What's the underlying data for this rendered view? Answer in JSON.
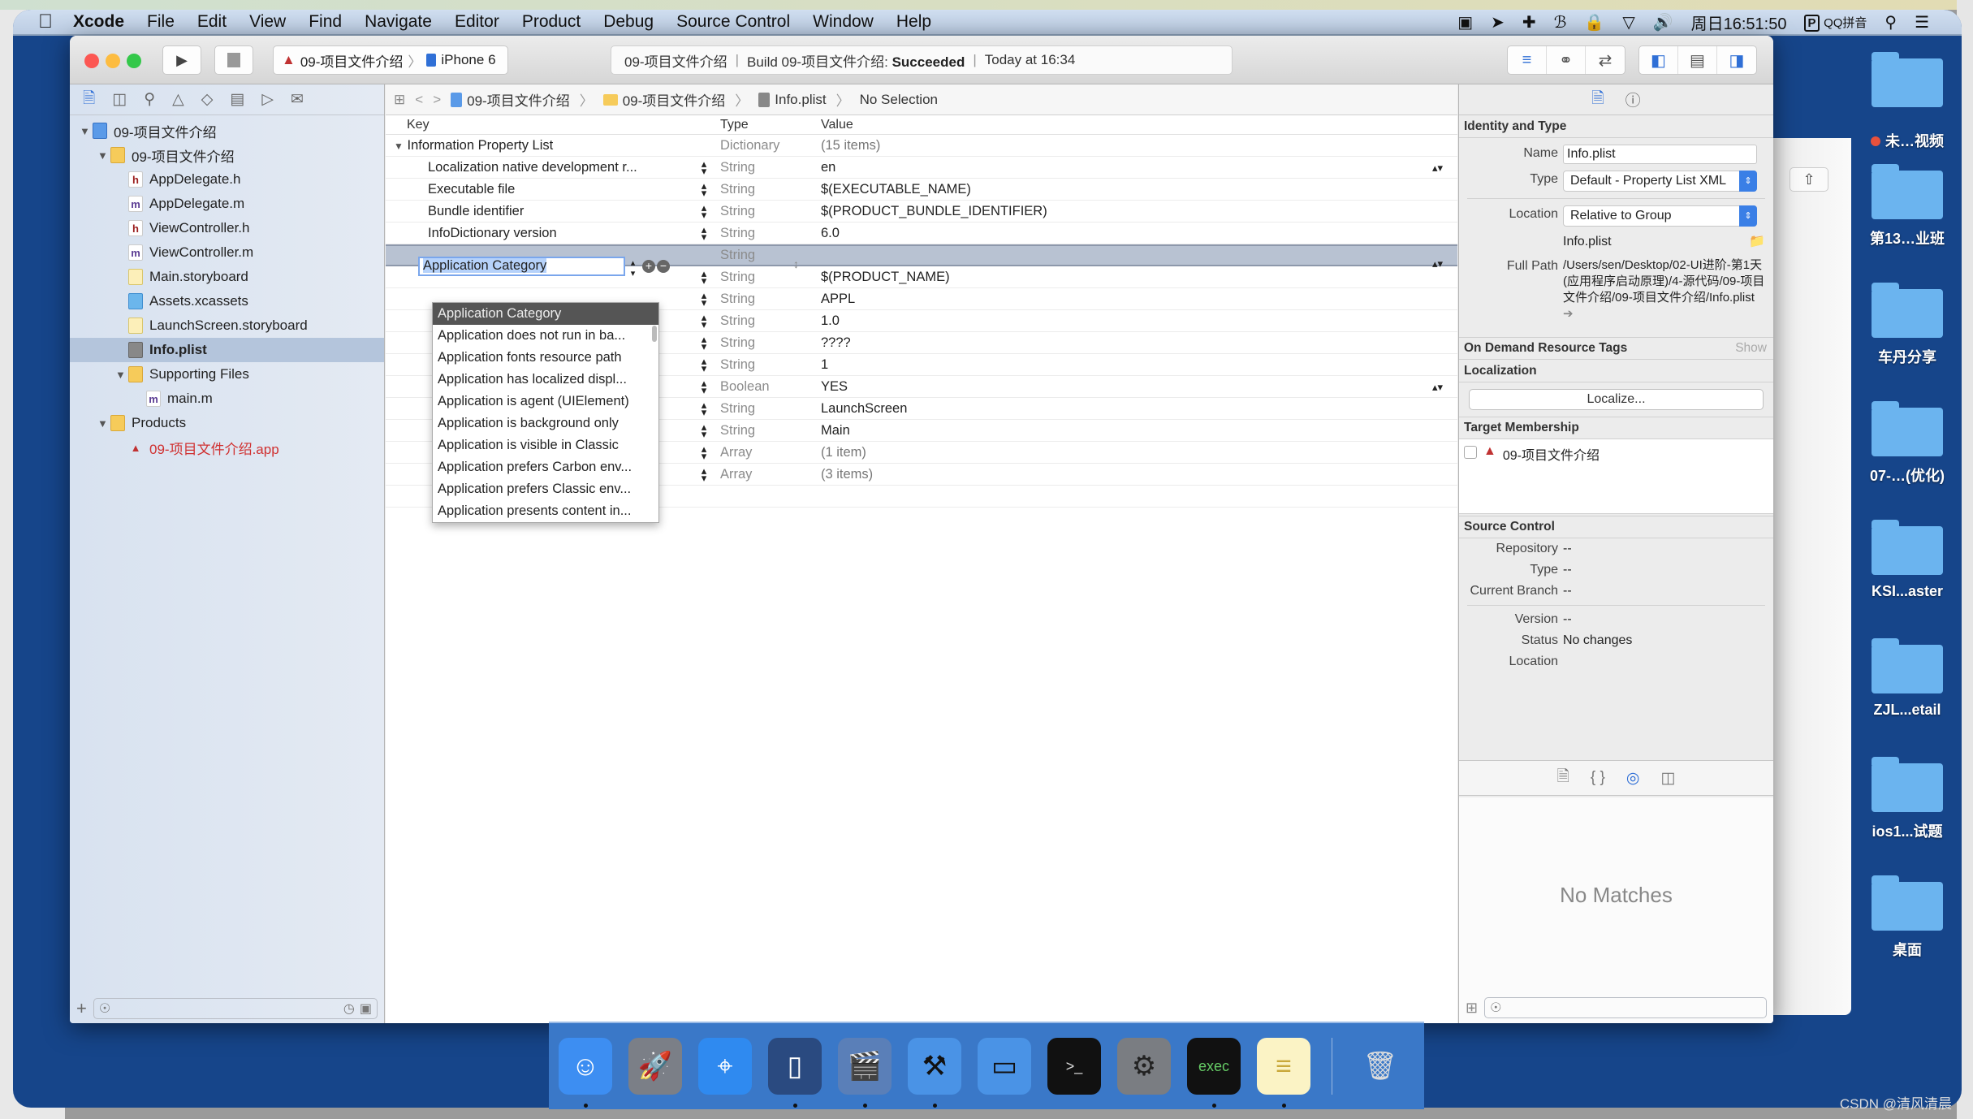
{
  "menubar": {
    "app_name": "Xcode",
    "items": [
      "File",
      "Edit",
      "View",
      "Find",
      "Navigate",
      "Editor",
      "Product",
      "Debug",
      "Source Control",
      "Window",
      "Help"
    ],
    "clock": "周日16:51:50",
    "input_method": "QQ拼音"
  },
  "toolbar": {
    "scheme_name": "09-项目文件介绍",
    "device": "iPhone 6",
    "status_project": "09-项目文件介绍",
    "status_build_prefix": "Build 09-项目文件介绍:",
    "status_build_result": "Succeeded",
    "status_time": "Today at 16:34"
  },
  "navigator": {
    "tree": [
      {
        "label": "09-项目文件介绍",
        "kind": "project",
        "depth": 0,
        "expanded": true
      },
      {
        "label": "09-项目文件介绍",
        "kind": "folder",
        "depth": 1,
        "expanded": true
      },
      {
        "label": "AppDelegate.h",
        "kind": "h",
        "depth": 2
      },
      {
        "label": "AppDelegate.m",
        "kind": "m",
        "depth": 2
      },
      {
        "label": "ViewController.h",
        "kind": "h",
        "depth": 2
      },
      {
        "label": "ViewController.m",
        "kind": "m",
        "depth": 2
      },
      {
        "label": "Main.storyboard",
        "kind": "storyboard",
        "depth": 2
      },
      {
        "label": "Assets.xcassets",
        "kind": "assets",
        "depth": 2
      },
      {
        "label": "LaunchScreen.storyboard",
        "kind": "storyboard",
        "depth": 2
      },
      {
        "label": "Info.plist",
        "kind": "plist",
        "depth": 2,
        "selected": true
      },
      {
        "label": "Supporting Files",
        "kind": "folder",
        "depth": 2,
        "expanded": true
      },
      {
        "label": "main.m",
        "kind": "m",
        "depth": 3
      },
      {
        "label": "Products",
        "kind": "folder",
        "depth": 1,
        "expanded": true
      },
      {
        "label": "09-项目文件介绍.app",
        "kind": "app",
        "depth": 2,
        "missing": true
      }
    ]
  },
  "jumpbar": {
    "crumbs": [
      "09-项目文件介绍",
      "09-项目文件介绍",
      "Info.plist",
      "No Selection"
    ]
  },
  "plist": {
    "headers": {
      "key": "Key",
      "type": "Type",
      "value": "Value"
    },
    "root": {
      "key": "Information Property List",
      "type": "Dictionary",
      "value": "(15 items)"
    },
    "rows": [
      {
        "key": "Localization native development r...",
        "type": "String",
        "value": "en",
        "value_stepper": true
      },
      {
        "key": "Executable file",
        "type": "String",
        "value": "$(EXECUTABLE_NAME)"
      },
      {
        "key": "Bundle identifier",
        "type": "String",
        "value": "$(PRODUCT_BUNDLE_IDENTIFIER)"
      },
      {
        "key": "InfoDictionary version",
        "type": "String",
        "value": "6.0"
      },
      {
        "key": "Application Category",
        "type": "String",
        "value": "",
        "editing": true
      },
      {
        "key": "",
        "type": "String",
        "value": "$(PRODUCT_NAME)"
      },
      {
        "key": "",
        "type": "String",
        "value": "APPL"
      },
      {
        "key": "",
        "type": "String",
        "value": "1.0"
      },
      {
        "key": "",
        "type": "String",
        "value": "????"
      },
      {
        "key": "",
        "type": "String",
        "value": "1"
      },
      {
        "key": "",
        "type": "Boolean",
        "value": "YES",
        "value_stepper": true
      },
      {
        "key": "",
        "type": "String",
        "value": "LaunchScreen"
      },
      {
        "key": "",
        "type": "String",
        "value": "Main"
      },
      {
        "key": "",
        "type": "Array",
        "value": "(1 item)",
        "collapsed": true
      },
      {
        "key": "",
        "type": "Array",
        "value": "(3 items)",
        "collapsed": true
      }
    ],
    "editing_key_value": "Application Category",
    "dropdown_options": [
      "Application Category",
      "Application does not run in ba...",
      "Application fonts resource path",
      "Application has localized displ...",
      "Application is agent (UIElement)",
      "Application is background only",
      "Application is visible in Classic",
      "Application prefers Carbon env...",
      "Application prefers Classic env...",
      "Application presents content in..."
    ],
    "dropdown_selected_index": 0
  },
  "inspector": {
    "identity": {
      "title": "Identity and Type",
      "name_label": "Name",
      "name_value": "Info.plist",
      "type_label": "Type",
      "type_value": "Default - Property List XML",
      "location_label": "Location",
      "location_value": "Relative to Group",
      "location_file": "Info.plist",
      "fullpath_label": "Full Path",
      "fullpath_value": "/Users/sen/Desktop/02-UI进阶-第1天(应用程序启动原理)/4-源代码/09-项目文件介绍/09-项目文件介绍/Info.plist"
    },
    "odr": {
      "title": "On Demand Resource Tags",
      "show": "Show"
    },
    "localization": {
      "title": "Localization",
      "button": "Localize..."
    },
    "target": {
      "title": "Target Membership",
      "target_name": "09-项目文件介绍",
      "checked": false
    },
    "source_control": {
      "title": "Source Control",
      "fields": [
        {
          "label": "Repository",
          "value": "--"
        },
        {
          "label": "Type",
          "value": "--"
        },
        {
          "label": "Current Branch",
          "value": "--"
        }
      ],
      "fields2": [
        {
          "label": "Version",
          "value": "--"
        },
        {
          "label": "Status",
          "value": "No changes"
        },
        {
          "label": "Location",
          "value": ""
        }
      ]
    },
    "library_empty": "No Matches"
  },
  "desktop": {
    "items": [
      {
        "label": "未…视频",
        "tag": "red"
      },
      {
        "label": "第13…业班"
      },
      {
        "label": "车丹分享"
      },
      {
        "label": "07-…(优化)"
      },
      {
        "label": "KSI...aster"
      },
      {
        "label": "ZJL...etail"
      },
      {
        "label": "ios1...试题"
      },
      {
        "label": "桌面"
      }
    ]
  },
  "dock": {
    "items": [
      {
        "name": "finder",
        "running": true
      },
      {
        "name": "launchpad",
        "running": false
      },
      {
        "name": "safari",
        "running": false
      },
      {
        "name": "mouse-app",
        "running": true
      },
      {
        "name": "photo-booth-video",
        "running": true
      },
      {
        "name": "xcode",
        "running": true
      },
      {
        "name": "simulator",
        "running": false
      },
      {
        "name": "terminal",
        "running": false
      },
      {
        "name": "system-preferences",
        "running": false
      },
      {
        "name": "console-exec",
        "running": true
      },
      {
        "name": "notes",
        "running": true
      },
      {
        "name": "trash",
        "running": false
      }
    ]
  },
  "watermark": "CSDN @清风清晨"
}
